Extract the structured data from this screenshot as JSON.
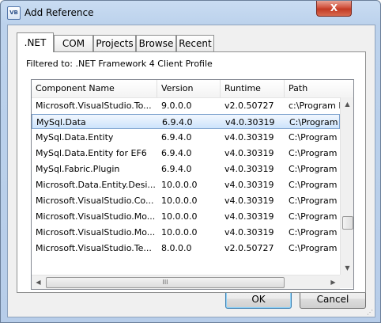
{
  "window": {
    "title": "Add Reference",
    "app_icon_text": "VB",
    "close_glyph": "X"
  },
  "tabs": [
    {
      "label": ".NET",
      "active": true
    },
    {
      "label": "COM",
      "active": false
    },
    {
      "label": "Projects",
      "active": false
    },
    {
      "label": "Browse",
      "active": false
    },
    {
      "label": "Recent",
      "active": false
    }
  ],
  "filter_text": "Filtered to: .NET Framework 4 Client Profile",
  "columns": [
    "Component Name",
    "Version",
    "Runtime",
    "Path"
  ],
  "rows": [
    {
      "name": "Microsoft.VisualStudio.To...",
      "version": "9.0.0.0",
      "runtime": "v2.0.50727",
      "path": "c:\\Program F",
      "selected": false
    },
    {
      "name": "MySql.Data",
      "version": "6.9.4.0",
      "runtime": "v4.0.30319",
      "path": "C:\\Program",
      "selected": true
    },
    {
      "name": "MySql.Data.Entity",
      "version": "6.9.4.0",
      "runtime": "v4.0.30319",
      "path": "C:\\Program",
      "selected": false
    },
    {
      "name": "MySql.Data.Entity for EF6",
      "version": "6.9.4.0",
      "runtime": "v4.0.30319",
      "path": "C:\\Program",
      "selected": false
    },
    {
      "name": "MySql.Fabric.Plugin",
      "version": "6.9.4.0",
      "runtime": "v4.0.30319",
      "path": "C:\\Program",
      "selected": false
    },
    {
      "name": "Microsoft.Data.Entity.Desi...",
      "version": "10.0.0.0",
      "runtime": "v4.0.30319",
      "path": "C:\\Program",
      "selected": false
    },
    {
      "name": "Microsoft.VisualStudio.Co...",
      "version": "10.0.0.0",
      "runtime": "v4.0.30319",
      "path": "C:\\Program",
      "selected": false
    },
    {
      "name": "Microsoft.VisualStudio.Mo...",
      "version": "10.0.0.0",
      "runtime": "v4.0.30319",
      "path": "C:\\Program",
      "selected": false
    },
    {
      "name": "Microsoft.VisualStudio.Mo...",
      "version": "10.0.0.0",
      "runtime": "v4.0.30319",
      "path": "C:\\Program",
      "selected": false
    },
    {
      "name": "Microsoft.VisualStudio.Te...",
      "version": "8.0.0.0",
      "runtime": "v2.0.50727",
      "path": "C:\\Program",
      "selected": false
    }
  ],
  "scrollbars": {
    "up_glyph": "▲",
    "down_glyph": "▼",
    "left_glyph": "◀",
    "right_glyph": "▶",
    "grip_glyph": "III"
  },
  "buttons": {
    "ok": "OK",
    "cancel": "Cancel"
  },
  "colors": {
    "selection": "#cde3fb",
    "title_bar": "#c9dcf2",
    "close": "#c23a24"
  }
}
